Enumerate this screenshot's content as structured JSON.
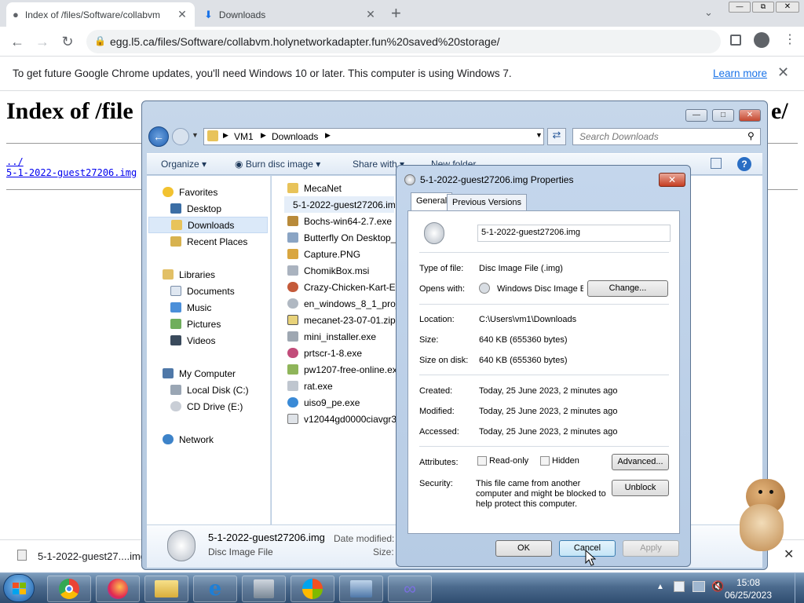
{
  "browser": {
    "tabs": [
      {
        "title": "Index of /files/Software/collabvm",
        "active": true
      },
      {
        "title": "Downloads",
        "active": false
      }
    ],
    "new_tab_label": "+",
    "address": "egg.l5.ca/files/Software/collabvm.holynetworkadapter.fun%20saved%20storage/",
    "infobar": {
      "message": "To get future Google Chrome updates, you'll need Windows 10 or later. This computer is using Windows 7.",
      "link": "Learn more"
    }
  },
  "page": {
    "title": "Index of /file",
    "title_tail": "e/",
    "links": [
      "../",
      "5-1-2022-guest27206.img"
    ]
  },
  "download_shelf": {
    "item": "5-1-2022-guest27....img"
  },
  "explorer": {
    "breadcrumb": [
      "VM1",
      "Downloads"
    ],
    "search_placeholder": "Search Downloads",
    "commands": [
      "Organize",
      "Burn disc image",
      "Share with",
      "New folder"
    ],
    "nav": {
      "favorites": "Favorites",
      "favorites_items": [
        "Desktop",
        "Downloads",
        "Recent Places"
      ],
      "libraries": "Libraries",
      "libraries_items": [
        "Documents",
        "Music",
        "Pictures",
        "Videos"
      ],
      "computer": "My Computer",
      "computer_items": [
        "Local Disk (C:)",
        "CD Drive (E:)"
      ],
      "network": "Network"
    },
    "files": [
      "MecaNet",
      "5-1-2022-guest27206.im",
      "Bochs-win64-2.7.exe",
      "Butterfly On Desktop_1",
      "Capture.PNG",
      "ChomikBox.msi",
      "Crazy-Chicken-Kart-Ext",
      "en_windows_8_1_pro_v",
      "mecanet-23-07-01.zip",
      "mini_installer.exe",
      "prtscr-1-8.exe",
      "pw1207-free-online.exe",
      "rat.exe",
      "uiso9_pe.exe",
      "v12044gd0000ciavgr3c7"
    ],
    "details": {
      "name": "5-1-2022-guest27206.img",
      "type": "Disc Image File",
      "modified_label": "Date modified:",
      "size_label": "Size:"
    }
  },
  "dialog": {
    "title": "5-1-2022-guest27206.img Properties",
    "tabs": [
      "General",
      "Previous Versions"
    ],
    "filename": "5-1-2022-guest27206.img",
    "type_label": "Type of file:",
    "type_value": "Disc Image File (.img)",
    "opens_label": "Opens with:",
    "opens_value": "Windows Disc Image Bı",
    "change_btn": "Change...",
    "location_label": "Location:",
    "location_value": "C:\\Users\\vm1\\Downloads",
    "size_label": "Size:",
    "size_value": "640 KB (655360 bytes)",
    "sizeondisk_label": "Size on disk:",
    "sizeondisk_value": "640 KB (655360 bytes)",
    "created_label": "Created:",
    "created_value": "Today, 25 June 2023, 2 minutes ago",
    "modified_label": "Modified:",
    "modified_value": "Today, 25 June 2023, 2 minutes ago",
    "accessed_label": "Accessed:",
    "accessed_value": "Today, 25 June 2023, 2 minutes ago",
    "attributes_label": "Attributes:",
    "readonly": "Read-only",
    "hidden": "Hidden",
    "advanced_btn": "Advanced...",
    "security_label": "Security:",
    "security_text_1": "This file came from another",
    "security_text_2": "computer and might be blocked to",
    "security_text_3": "help protect this computer.",
    "unblock_btn": "Unblock",
    "ok": "OK",
    "cancel": "Cancel",
    "apply": "Apply"
  },
  "taskbar": {
    "time": "15:08",
    "date": "06/25/2023"
  }
}
